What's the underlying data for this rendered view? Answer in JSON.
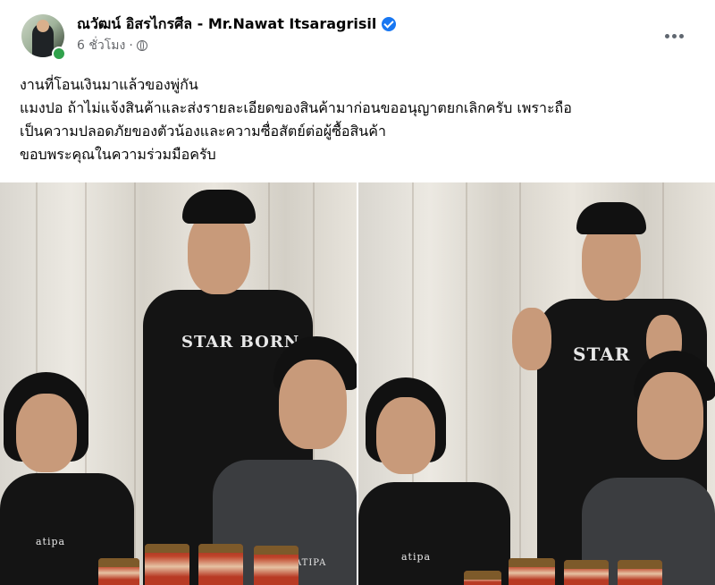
{
  "post": {
    "author": "ณวัฒน์ อิสรไกรศีล - Mr.Nawat Itsaragrisil",
    "time": "6 ชั่วโมง",
    "separator": "·",
    "lines": [
      "งานที่โอนเงินมาแล้วของพู่กัน",
      "แมงปอ ถ้าไม่แจ้งสินค้าและส่งรายละเอียดของสินค้ามาก่อนขออนุญาตยกเลิกครับ เพราะถือ",
      "เป็นความปลอดภัยของตัวน้องและความซื่อสัตย์ต่อผู้ซื้อสินค้า",
      "ขอบพระคุณในความร่วมมือครับ"
    ],
    "shirt_print": "STAR BORN",
    "shirt_print_right": "STAR",
    "shirt_small": "atipa",
    "shirt_gray": "ATIPA"
  },
  "colors": {
    "verified": "#1877f2",
    "online": "#31a24c",
    "meta": "#65676b"
  },
  "icons": [
    "verified-badge-icon",
    "globe-icon",
    "more-options-icon"
  ]
}
